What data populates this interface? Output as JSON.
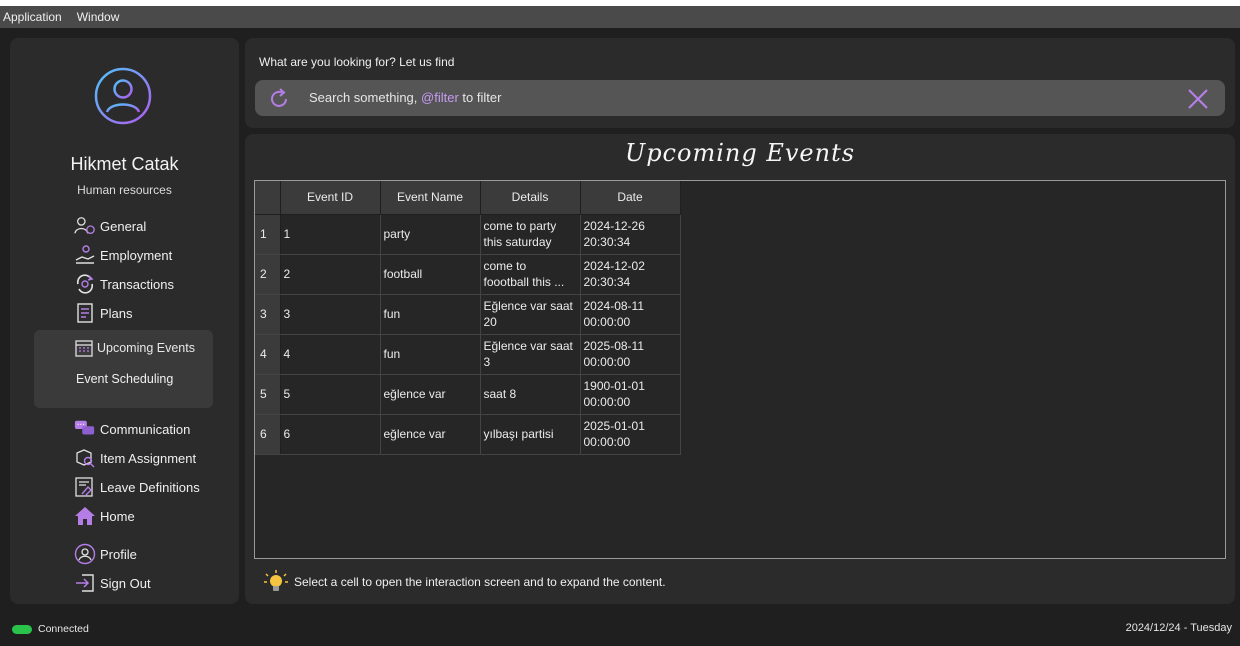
{
  "menubar": {
    "items": [
      "Application",
      "Window"
    ]
  },
  "user": {
    "name": "Hikmet Catak",
    "role": "Human resources"
  },
  "sidebar": {
    "items": [
      {
        "label": "General",
        "icon": "user-group-icon"
      },
      {
        "label": "Employment",
        "icon": "hand-person-icon"
      },
      {
        "label": "Transactions",
        "icon": "cycle-gear-icon"
      },
      {
        "label": "Plans",
        "icon": "plans-icon"
      }
    ],
    "group": {
      "item": "Upcoming Events",
      "icon": "calendar-icon",
      "subitem": "Event Scheduling"
    },
    "items2": [
      {
        "label": "Communication",
        "icon": "chat-icon"
      },
      {
        "label": "Item Assignment",
        "icon": "box-search-icon"
      },
      {
        "label": "Leave Definitions",
        "icon": "leave-doc-icon"
      },
      {
        "label": "Home",
        "icon": "home-icon"
      }
    ],
    "items3": [
      {
        "label": "Profile",
        "icon": "profile-icon"
      },
      {
        "label": "Sign Out",
        "icon": "sign-out-icon"
      }
    ]
  },
  "search": {
    "label": "What are you looking for? Let us find",
    "placeholder_prefix": "Search something, ",
    "placeholder_highlight": "@filter",
    "placeholder_suffix": " to filter"
  },
  "main": {
    "title": "Upcoming Events"
  },
  "table": {
    "columns": [
      "Event ID",
      "Event Name",
      "Details",
      "Date"
    ],
    "rows": [
      {
        "num": "1",
        "id": "1",
        "name": "party",
        "details": [
          "come to party",
          "this saturday"
        ],
        "date": [
          "2024-12-26",
          "20:30:34"
        ]
      },
      {
        "num": "2",
        "id": "2",
        "name": "football",
        "details": [
          "come to",
          "foootball this ..."
        ],
        "date": [
          "2024-12-02",
          "20:30:34"
        ]
      },
      {
        "num": "3",
        "id": "3",
        "name": "fun",
        "details": [
          "Eğlence var saat",
          "20"
        ],
        "date": [
          "2024-08-11",
          "00:00:00"
        ]
      },
      {
        "num": "4",
        "id": "4",
        "name": "fun",
        "details": [
          "Eğlence var saat 3"
        ],
        "date": [
          "2025-08-11",
          "00:00:00"
        ]
      },
      {
        "num": "5",
        "id": "5",
        "name": "eğlence var",
        "details": [
          "saat 8"
        ],
        "date": [
          "1900-01-01",
          "00:00:00"
        ]
      },
      {
        "num": "6",
        "id": "6",
        "name": "eğlence var",
        "details": [
          "yılbaşı partisi"
        ],
        "date": [
          "2025-01-01",
          "00:00:00"
        ]
      }
    ]
  },
  "hint": {
    "text": "Select a cell to open the interaction screen and to expand the content."
  },
  "status": {
    "connection": "Connected",
    "datetime": "2024/12/24 - Tuesday"
  },
  "colors": {
    "accent": "#b57ee6",
    "status_ok": "#29c24a"
  }
}
